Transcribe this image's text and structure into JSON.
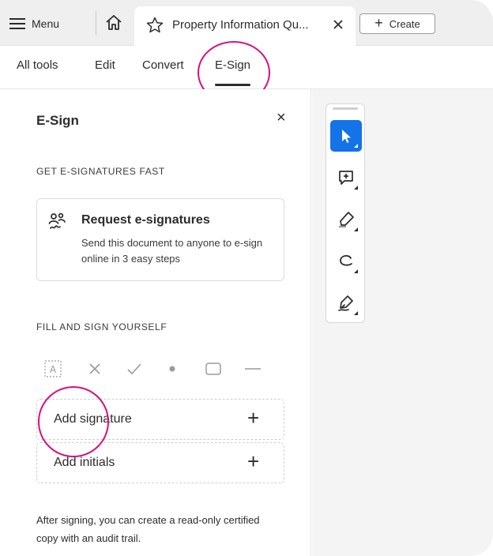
{
  "tabstrip": {
    "menu_label": "Menu",
    "doc_tab_title": "Property Information Qu...",
    "create_label": "Create"
  },
  "toolbar": {
    "items": [
      {
        "label": "All tools",
        "active": false
      },
      {
        "label": "Edit",
        "active": false
      },
      {
        "label": "Convert",
        "active": false
      },
      {
        "label": "E-Sign",
        "active": true
      }
    ]
  },
  "panel": {
    "title": "E-Sign",
    "close_glyph": "×",
    "section_fast": "GET E-SIGNATURES FAST",
    "request": {
      "icon": "request-signatures-icon",
      "title": "Request e-signatures",
      "description": "Send this document to anyone to e-sign online in 3 easy steps"
    },
    "section_fill": "FILL AND SIGN YOURSELF",
    "fill_tools": [
      {
        "icon": "text-field-icon",
        "glyph": "A"
      },
      {
        "icon": "cross-mark-icon",
        "glyph": "✕"
      },
      {
        "icon": "check-mark-icon",
        "glyph": "✓"
      },
      {
        "icon": "dot-icon",
        "glyph": "●"
      },
      {
        "icon": "rectangle-icon",
        "glyph": "▢"
      },
      {
        "icon": "line-icon",
        "glyph": "—"
      }
    ],
    "add_signature": "Add signature",
    "add_initials": "Add initials",
    "after_note": "After signing, you can create a read-only certified copy with an audit trail."
  },
  "palette": {
    "tools": [
      {
        "icon": "select-cursor-icon",
        "active": true
      },
      {
        "icon": "add-comment-icon",
        "active": false
      },
      {
        "icon": "highlight-pen-icon",
        "active": false
      },
      {
        "icon": "draw-freehand-icon",
        "active": false
      },
      {
        "icon": "sign-pen-icon",
        "active": false
      }
    ]
  },
  "colors": {
    "accent": "#1473e6",
    "highlight_ring": "#d6107c",
    "tabstrip_bg": "#efefef"
  }
}
